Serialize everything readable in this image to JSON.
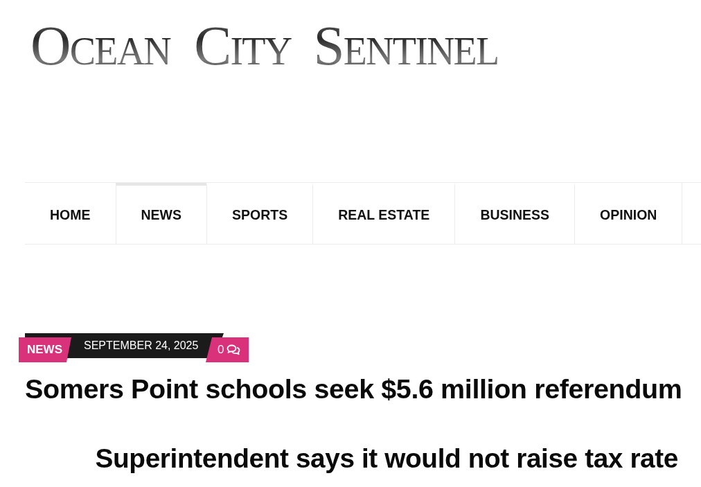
{
  "masthead": {
    "logo": "OCEAN CITY SENTINEL"
  },
  "nav": {
    "items": [
      {
        "label": "HOME",
        "selected": false
      },
      {
        "label": "NEWS",
        "selected": true
      },
      {
        "label": "SPORTS",
        "selected": false
      },
      {
        "label": "REAL ESTATE",
        "selected": false
      },
      {
        "label": "BUSINESS",
        "selected": false
      },
      {
        "label": "OPINION",
        "selected": false
      }
    ]
  },
  "article": {
    "category": "NEWS",
    "date": "SEPTEMBER 24, 2025",
    "comments": "0",
    "title": "Somers Point schools seek $5.6 million referendum",
    "subtitle": "Superintendent says it would not raise tax rate"
  }
}
